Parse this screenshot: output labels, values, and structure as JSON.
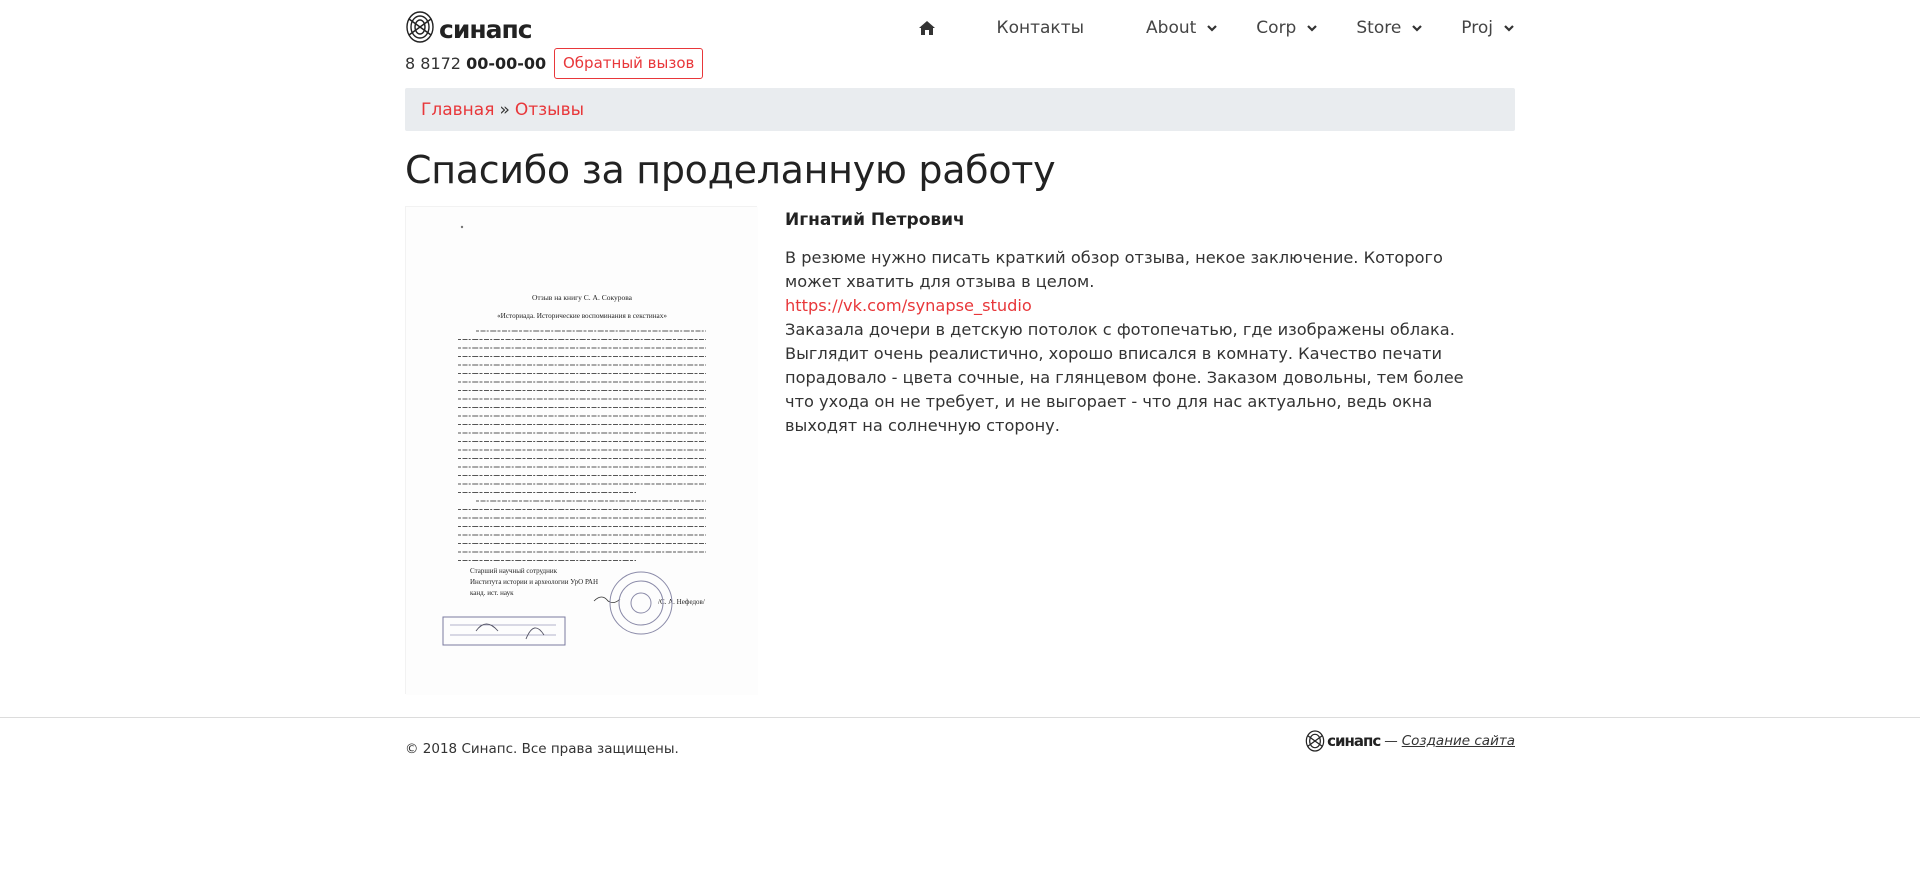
{
  "header": {
    "logo_text": "синапс",
    "phone_prefix": "8 8172",
    "phone_number": "00-00-00",
    "callback_label": "Обратный вызов"
  },
  "nav": {
    "home_icon": "home-icon",
    "items": [
      {
        "label": "Контакты",
        "dropdown": false
      },
      {
        "label": "About",
        "dropdown": true
      },
      {
        "label": "Corp",
        "dropdown": true
      },
      {
        "label": "Store",
        "dropdown": true
      },
      {
        "label": "Proj",
        "dropdown": true
      }
    ]
  },
  "breadcrumb": {
    "home": "Главная",
    "separator": "»",
    "current": "Отзывы"
  },
  "page_title": "Спасибо за проделанную работу",
  "review": {
    "author": "Игнатий Петрович",
    "summary": "В резюме нужно писать краткий обзор отзыва, некое заключение. Которого может хватить для отзыва в целом.",
    "link": "https://vk.com/synapse_studio",
    "text": "Заказала дочери в детскую потолок с фотопечатью, где изображены облака. Выглядит очень реалистично, хорошо вписался в комнату. Качество печати порадовало - цвета сочные, на глянцевом фоне. Заказом довольны, тем более что ухода он не требует, и не выгорает - что для нас актуально, ведь окна выходят на солнечную сторону."
  },
  "document": {
    "heading": "Отзыв на книгу С. А. Сокурова",
    "subheading": "«Историада. Исторические воспоминания в секстинах»",
    "signature_block": [
      "Старший научный сотрудник",
      "Института истории и археологии УрО РАН",
      "канд. ист. наук"
    ],
    "signer": "/С. А. Нефедов/"
  },
  "footer": {
    "copyright": "© 2018 Синапс. Все права защищены.",
    "logo_text": "синапс",
    "dash": "—",
    "credit_link": "Создание сайта"
  },
  "colors": {
    "accent": "#e8373a",
    "breadcrumb_bg": "#e9ecef",
    "text": "#333333"
  }
}
